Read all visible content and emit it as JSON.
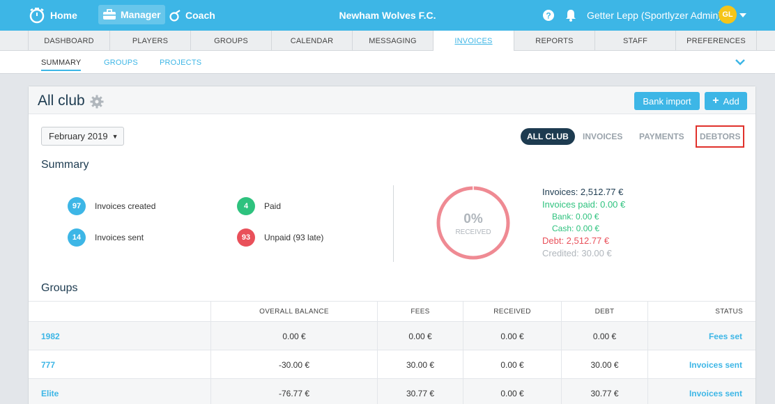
{
  "topbar": {
    "home_label": "Home",
    "manager_label": "Manager",
    "coach_label": "Coach",
    "club_name": "Newham Wolves F.C.",
    "user_name": "Getter Lepp (Sportlyzer Admin)",
    "avatar_initials": "GL"
  },
  "main_nav": {
    "tabs": [
      {
        "label": "DASHBOARD"
      },
      {
        "label": "PLAYERS"
      },
      {
        "label": "GROUPS"
      },
      {
        "label": "CALENDAR"
      },
      {
        "label": "MESSAGING"
      },
      {
        "label": "INVOICES"
      },
      {
        "label": "REPORTS"
      },
      {
        "label": "STAFF"
      },
      {
        "label": "PREFERENCES"
      }
    ],
    "active": "INVOICES"
  },
  "sub_nav": {
    "tabs": [
      {
        "label": "SUMMARY"
      },
      {
        "label": "GROUPS"
      },
      {
        "label": "PROJECTS"
      }
    ],
    "active": "SUMMARY"
  },
  "card": {
    "title": "All club",
    "bank_import_label": "Bank import",
    "add_label": "Add",
    "month": "February 2019",
    "view_tabs": [
      {
        "label": "ALL CLUB"
      },
      {
        "label": "INVOICES"
      },
      {
        "label": "PAYMENTS"
      },
      {
        "label": "DEBTORS"
      }
    ]
  },
  "summary": {
    "title": "Summary",
    "stats": [
      {
        "count": "97",
        "label": "Invoices created",
        "color": "#3db6e6"
      },
      {
        "count": "14",
        "label": "Invoices sent",
        "color": "#3db6e6"
      },
      {
        "count": "4",
        "label": "Paid",
        "color": "#2ec27e"
      },
      {
        "count": "93",
        "label": "Unpaid (93 late)",
        "color": "#e9505a"
      }
    ],
    "received_percent": "0%",
    "received_label": "RECEIVED",
    "received_fraction": 0.0,
    "totals": {
      "invoices": "Invoices: 2,512.77 €",
      "paid": "Invoices paid: 0.00 €",
      "bank": "Bank: 0.00 €",
      "cash": "Cash: 0.00 €",
      "debt": "Debt: 2,512.77 €",
      "credited": "Credited: 30.00 €"
    }
  },
  "groups": {
    "title": "Groups",
    "columns": [
      "",
      "OVERALL BALANCE",
      "FEES",
      "RECEIVED",
      "DEBT",
      "STATUS"
    ],
    "rows": [
      {
        "name": "1982",
        "balance": "0.00 €",
        "fees": "0.00 €",
        "received": "0.00 €",
        "debt": "0.00 €",
        "status": "Fees set"
      },
      {
        "name": "777",
        "balance": "-30.00 €",
        "fees": "30.00 €",
        "received": "0.00 €",
        "debt": "30.00 €",
        "status": "Invoices sent"
      },
      {
        "name": "Elite",
        "balance": "-76.77 €",
        "fees": "30.77 €",
        "received": "0.00 €",
        "debt": "30.77 €",
        "status": "Invoices sent"
      }
    ]
  },
  "colors": {
    "accent": "#3db6e6",
    "navy": "#1d3b50",
    "green": "#2ec27e",
    "red": "#e9505a",
    "highlight": "#e0312b",
    "donut_ring": "#ef8a93"
  }
}
